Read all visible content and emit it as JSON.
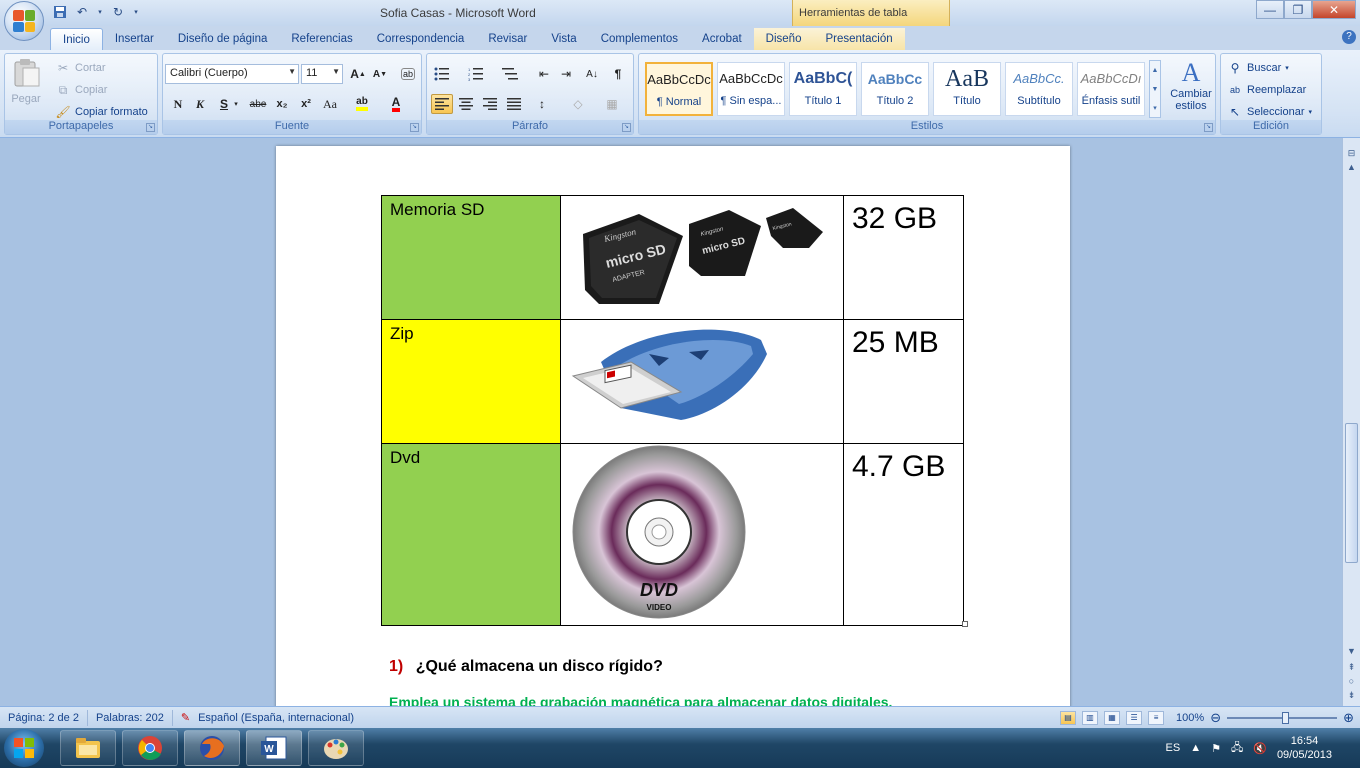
{
  "window": {
    "title": "Sofia Casas - Microsoft Word",
    "context_header": "Herramientas de tabla"
  },
  "tabs": [
    "Inicio",
    "Insertar",
    "Diseño de página",
    "Referencias",
    "Correspondencia",
    "Revisar",
    "Vista",
    "Complementos",
    "Acrobat",
    "Diseño",
    "Presentación"
  ],
  "ribbon": {
    "clipboard": {
      "label": "Portapapeles",
      "paste": "Pegar",
      "cut": "Cortar",
      "copy": "Copiar",
      "format_painter": "Copiar formato"
    },
    "font": {
      "label": "Fuente",
      "family": "Calibri (Cuerpo)",
      "size": "11",
      "bold": "N",
      "italic": "K",
      "underline": "S",
      "strike": "abe",
      "subscript": "x₂",
      "superscript": "x²",
      "case": "Aa"
    },
    "paragraph": {
      "label": "Párrafo",
      "pilcrow": "¶"
    },
    "styles": {
      "label": "Estilos",
      "items": [
        {
          "sample": "AaBbCcDc",
          "name": "¶ Normal"
        },
        {
          "sample": "AaBbCcDc",
          "name": "¶ Sin espa..."
        },
        {
          "sample": "AaBbC(",
          "name": "Título 1"
        },
        {
          "sample": "AaBbCc",
          "name": "Título 2"
        },
        {
          "sample": "AaB",
          "name": "Título"
        },
        {
          "sample": "AaBbCc.",
          "name": "Subtítulo"
        },
        {
          "sample": "AaBbCcDı",
          "name": "Énfasis sutil"
        }
      ],
      "change": "Cambiar estilos"
    },
    "editing": {
      "label": "Edición",
      "find": "Buscar",
      "replace": "Reemplazar",
      "select": "Seleccionar"
    }
  },
  "document": {
    "table": [
      {
        "name": "Memoria SD",
        "capacity": "32 GB",
        "image": "micro-sd-card-adapter-image"
      },
      {
        "name": "Zip",
        "capacity": "25 MB",
        "image": "zip-drive-image"
      },
      {
        "name": "Dvd",
        "capacity": "4.7 GB",
        "image": "dvd-disc-image"
      }
    ],
    "sd_card_text": [
      "Kingston",
      "micro SD",
      "ADAPTER"
    ],
    "dvd_label": "DVD",
    "dvd_sublabel": "VIDEO",
    "question_number": "1)",
    "question": "¿Qué almacena un disco rígido?",
    "answer": "Emplea un sistema de grabación magnética para almacenar datos digitales."
  },
  "statusbar": {
    "page": "Página: 2 de 2",
    "words": "Palabras: 202",
    "language": "Español (España, internacional)",
    "zoom": "100%"
  },
  "taskbar": {
    "language": "ES",
    "time": "16:54",
    "date": "09/05/2013"
  },
  "colors": {
    "row_green": "#92d050",
    "row_yellow": "#ffff00",
    "answer_green": "#00b050",
    "question_number_red": "#c00000"
  }
}
